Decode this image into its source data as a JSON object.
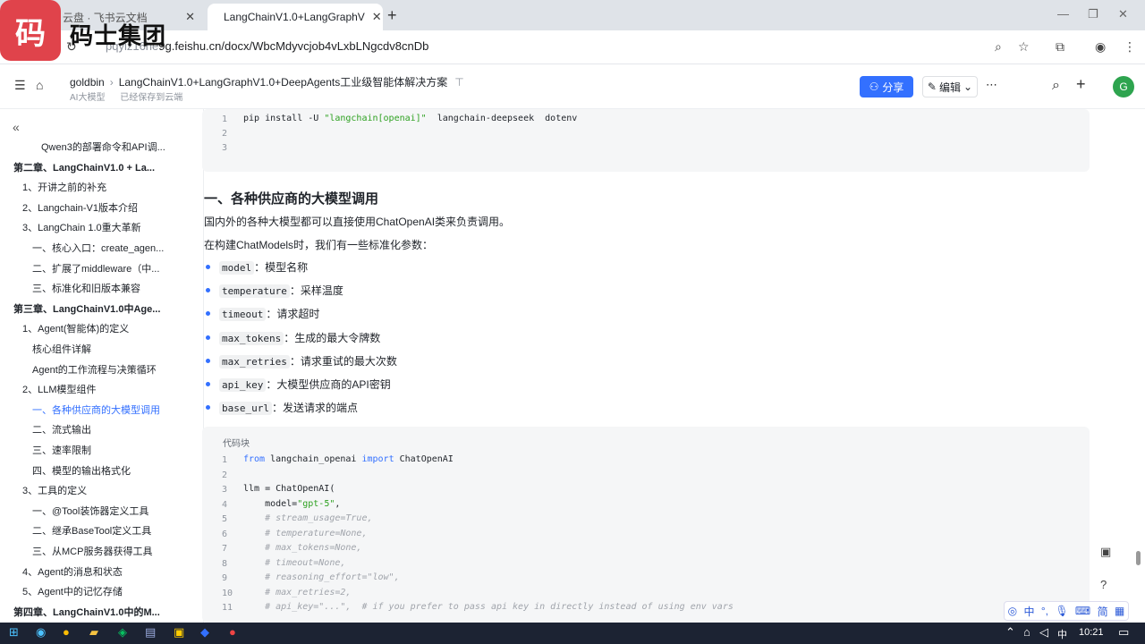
{
  "browser": {
    "tab1_title": "云盘 · 飞书云文档",
    "tab2_title": "LangChainV1.0+LangGraphV",
    "url_host": "pqyiz16he",
    "url_rest": "9g.feishu.cn/docx/WbcMdyvcjob4vLxbLNgcdv8cnDb",
    "brand": "码士集团",
    "logo_char": "码"
  },
  "header": {
    "breadcrumb_root": "goldbin",
    "breadcrumb_title": "LangChainV1.0+LangGraphV1.0+DeepAgents工业级智能体解决方案",
    "tag": "AI大模型",
    "saved": "已经保存到云端",
    "share_label": "分享",
    "edit_label": "编辑",
    "avatar_letter": "G"
  },
  "toc": [
    {
      "label": "Qwen3的部署命令和API调...",
      "level": 3
    },
    {
      "label": "第二章、LangChainV1.0 + La...",
      "level": 1
    },
    {
      "label": "1、开讲之前的补充",
      "level": 2
    },
    {
      "label": "2、Langchain-V1版本介绍",
      "level": 2
    },
    {
      "label": "3、LangChain 1.0重大革新",
      "level": 2
    },
    {
      "label": "一、核心入口：create_agen...",
      "level": 3
    },
    {
      "label": "二、扩展了middleware（中...",
      "level": 3
    },
    {
      "label": "三、标准化和旧版本兼容",
      "level": 3
    },
    {
      "label": "第三章、LangChainV1.0中Age...",
      "level": 1
    },
    {
      "label": "1、Agent(智能体)的定义",
      "level": 2
    },
    {
      "label": "核心组件详解",
      "level": 3
    },
    {
      "label": "Agent的工作流程与决策循环",
      "level": 3
    },
    {
      "label": "2、LLM模型组件",
      "level": 2
    },
    {
      "label": "一、各种供应商的大模型调用",
      "level": 3,
      "active": true
    },
    {
      "label": "二、流式输出",
      "level": 3
    },
    {
      "label": "三、速率限制",
      "level": 3
    },
    {
      "label": "四、模型的输出格式化",
      "level": 3
    },
    {
      "label": "3、工具的定义",
      "level": 2
    },
    {
      "label": "一、@Tool装饰器定义工具",
      "level": 3
    },
    {
      "label": "二、继承BaseTool定义工具",
      "level": 3
    },
    {
      "label": "三、从MCP服务器获得工具",
      "level": 3
    },
    {
      "label": "4、Agent的消息和状态",
      "level": 2
    },
    {
      "label": "5、Agent中的记忆存储",
      "level": 2
    },
    {
      "label": "第四章、LangChainV1.0中的M...",
      "level": 1
    }
  ],
  "doc": {
    "pip_cmd": "pip install -U ",
    "pip_pkg": "\"langchain[openai]\"",
    "pip_rest": "  langchain-deepseek  dotenv",
    "heading": "一、各种供应商的大模型调用",
    "para1": "国内外的各种大模型都可以直接使用ChatOpenAI类来负责调用。",
    "para2": "在构建ChatModels时，我们有一些标准化参数：",
    "params": [
      {
        "code": "model",
        "desc": "：模型名称"
      },
      {
        "code": "temperature",
        "desc": "：采样温度"
      },
      {
        "code": "timeout",
        "desc": "：请求超时"
      },
      {
        "code": "max_tokens",
        "desc": "：生成的最大令牌数"
      },
      {
        "code": "max_retries",
        "desc": "：请求重试的最大次数"
      },
      {
        "code": "api_key",
        "desc": "：大模型供应商的API密钥"
      },
      {
        "code": "base_url",
        "desc": "：发送请求的端点"
      }
    ],
    "codeblock_label": "代码块",
    "code_lines": [
      {
        "n": "1",
        "t": "from langchain_openai import ChatOpenAI",
        "k": "mixed1"
      },
      {
        "n": "2",
        "t": "",
        "k": "plain"
      },
      {
        "n": "3",
        "t": "llm = ChatOpenAI(",
        "k": "plain"
      },
      {
        "n": "4",
        "t": "    model=\"gpt-5\",",
        "k": "model"
      },
      {
        "n": "5",
        "t": "    # stream_usage=True,",
        "k": "cm"
      },
      {
        "n": "6",
        "t": "    # temperature=None,",
        "k": "cm"
      },
      {
        "n": "7",
        "t": "    # max_tokens=None,",
        "k": "cm"
      },
      {
        "n": "8",
        "t": "    # timeout=None,",
        "k": "cm"
      },
      {
        "n": "9",
        "t": "    # reasoning_effort=\"low\",",
        "k": "cm"
      },
      {
        "n": "10",
        "t": "    # max_retries=2,",
        "k": "cm"
      },
      {
        "n": "11",
        "t": "    # api_key=\"...\",  # if you prefer to pass api key in directly instead of using env vars",
        "k": "cm"
      }
    ]
  },
  "system": {
    "time": "10:21",
    "ime_lang": "中",
    "ime_simp": "简"
  }
}
